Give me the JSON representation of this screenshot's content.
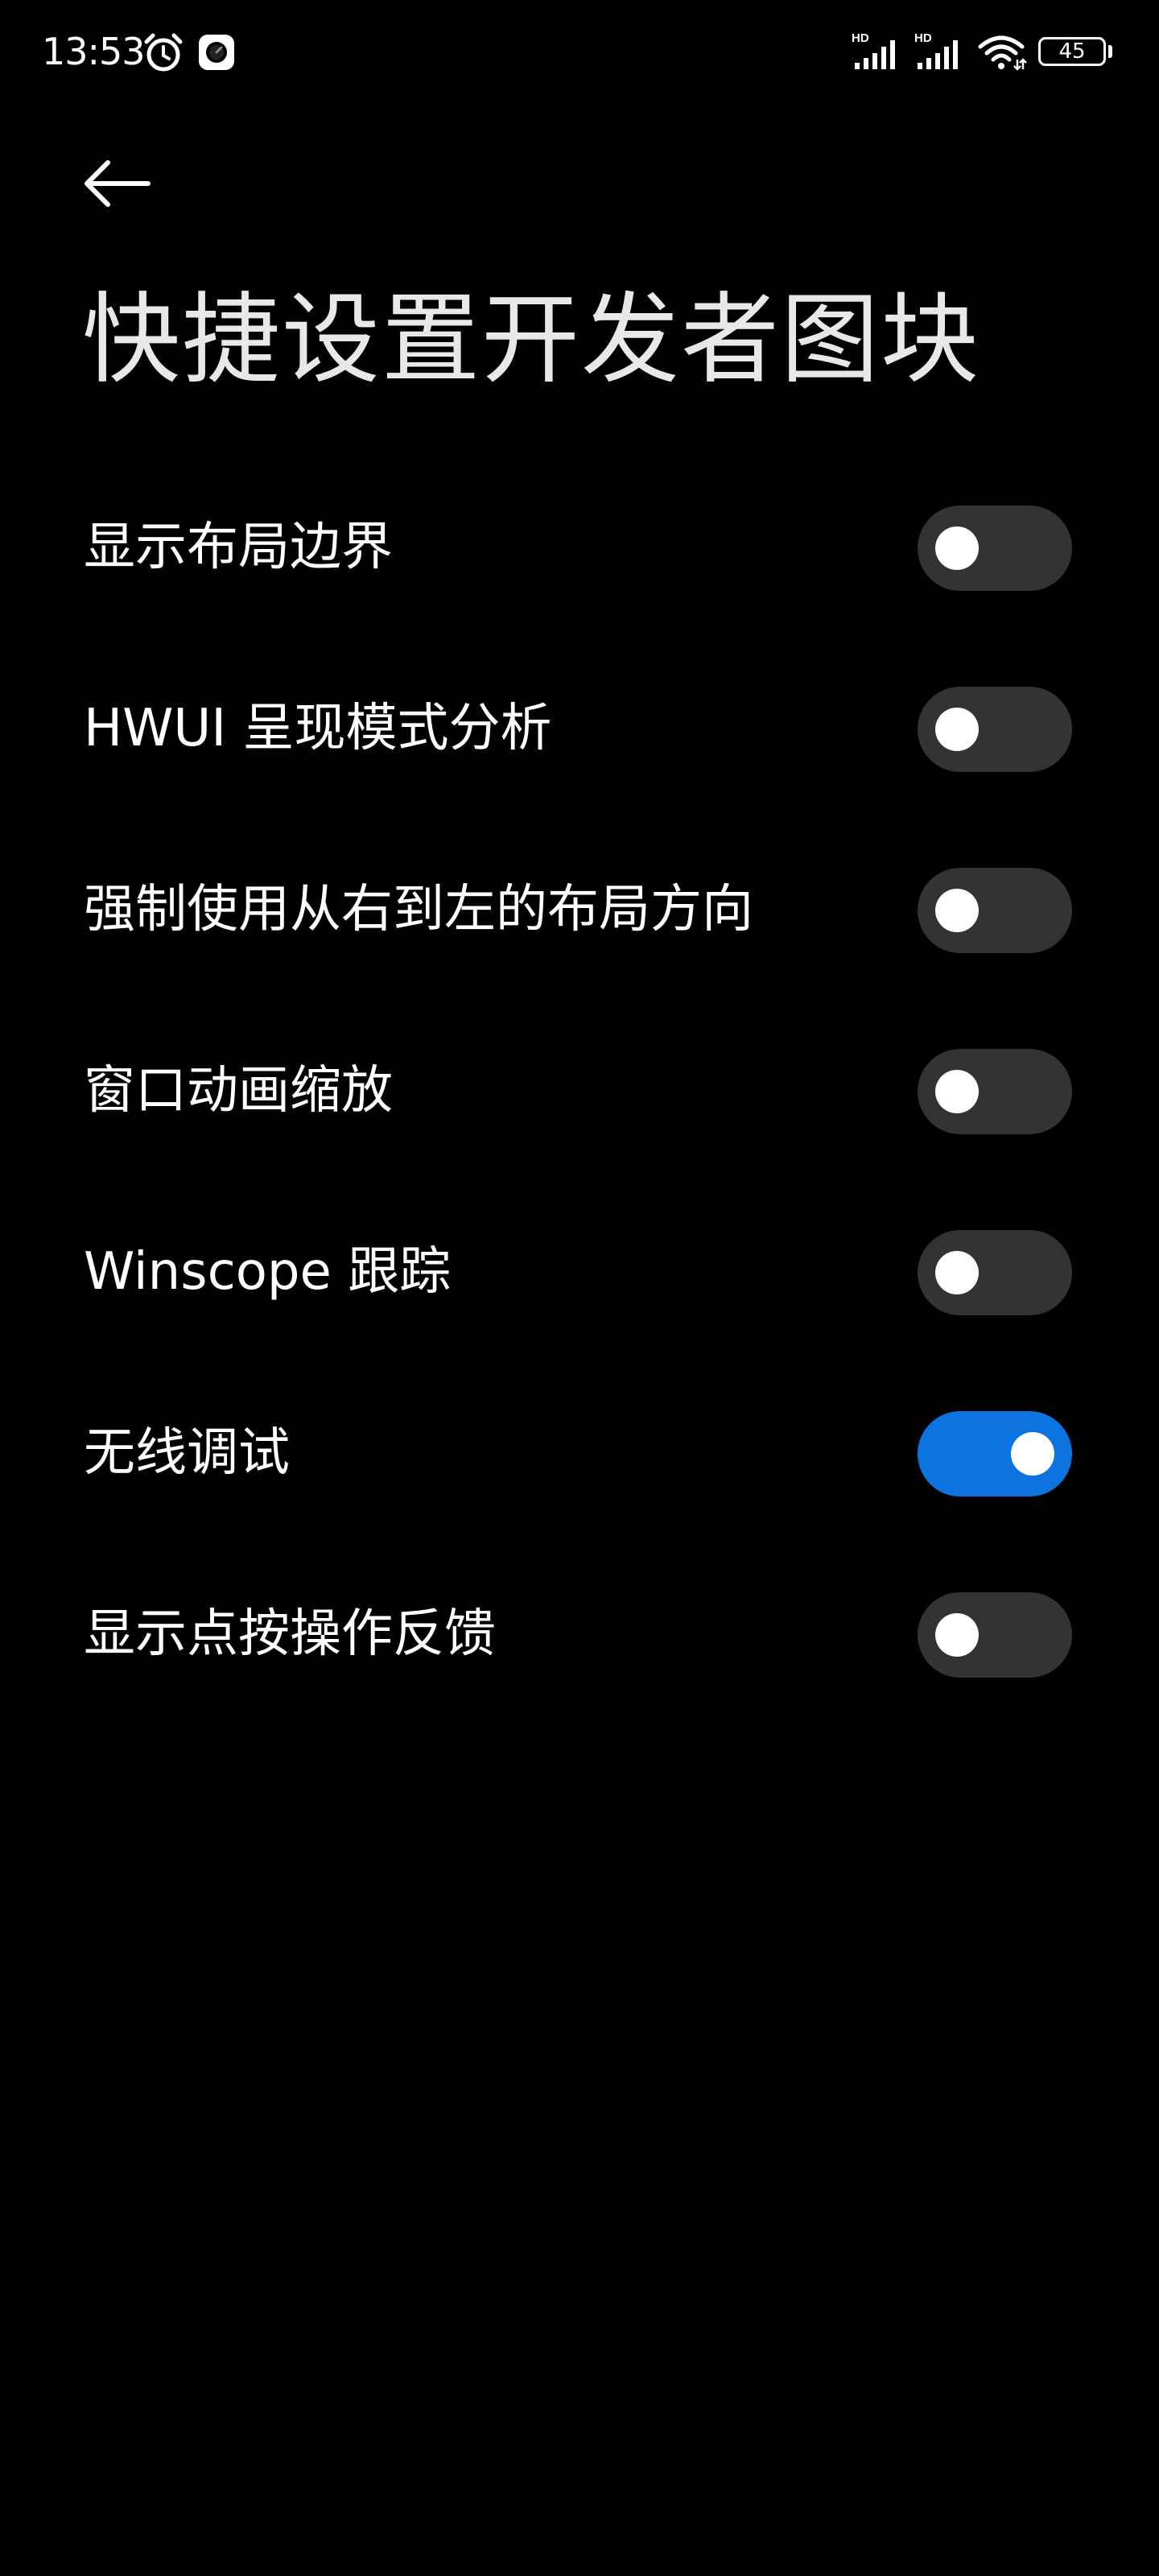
{
  "status_bar": {
    "time": "13:53",
    "battery_level": "45",
    "signal_label_1": "HD",
    "signal_label_2": "HD",
    "icons": [
      "alarm-icon",
      "app-icon",
      "signal-icon",
      "signal-icon",
      "wifi-icon",
      "battery-icon"
    ]
  },
  "header": {
    "back_icon": "arrow-left-icon",
    "title": "快捷设置开发者图块"
  },
  "settings": [
    {
      "label": "显示布局边界",
      "enabled": false
    },
    {
      "label": "HWUI 呈现模式分析",
      "enabled": false
    },
    {
      "label": "强制使用从右到左的布局方向",
      "enabled": false
    },
    {
      "label": "窗口动画缩放",
      "enabled": false
    },
    {
      "label": "Winscope 跟踪",
      "enabled": false
    },
    {
      "label": "无线调试",
      "enabled": true
    },
    {
      "label": "显示点按操作反馈",
      "enabled": false
    }
  ],
  "colors": {
    "background": "#000000",
    "toggle_off": "#333333",
    "toggle_on": "#0b74e0",
    "knob": "#ffffff"
  }
}
